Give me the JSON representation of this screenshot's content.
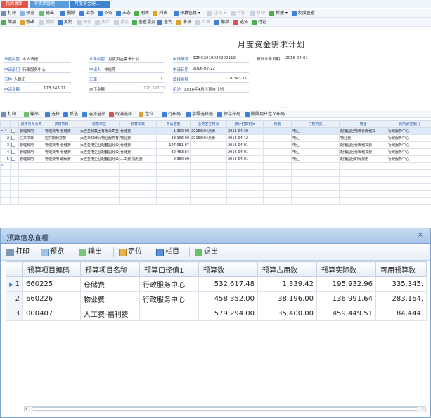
{
  "tabs": {
    "t1": "我的桌面",
    "t2": "申请单管理",
    "t3": "月度资金需…"
  },
  "toolbar1": {
    "print": "打印",
    "preview": "预览",
    "export": "输出",
    "delete": "删除",
    "first": "上条",
    "next": "下条",
    "last": "末条",
    "refresh": "刷新",
    "list": "列表",
    "budget": "预算信息",
    "attach": "注释",
    "pay": "付款",
    "send": "打印",
    "new": "新建",
    "make": "制度查看"
  },
  "toolbar2": {
    "add": "增加",
    "modify": "修改",
    "del": "删除",
    "copy": "复制",
    "save": "保存",
    "cancel": "放弃",
    "submit": "提交",
    "query_submit": "查看提交",
    "query": "查询",
    "review": "审核",
    "unreview": "弃审",
    "revoke": "撤单",
    "select": "选择",
    "discuss": "讨论"
  },
  "form": {
    "title": "月度资金需求计划",
    "doc_type_label": "单据类型",
    "doc_type": "本人填报",
    "biz_type_label": "业务类型",
    "biz_type": "月度资金需求计划",
    "doc_no_label": "申请编号",
    "doc_no": "ZZNC2019022200110",
    "date_label": "预计业务日期",
    "date": "2016-04-01",
    "dept_label": "申请部门",
    "dept": "行政服务中心",
    "applicant_label": "申请人",
    "applicant": "林晓燕",
    "apply_date_label": "申请日期",
    "apply_date": "2016-02-22",
    "currency_label": "币种",
    "currency": "人民币",
    "rate_label": "汇率",
    "rate": "1",
    "amount_label": "填报金额",
    "amount": "178,343.71",
    "req_amount_label": "申请金额",
    "req_amount": "178,343.71",
    "local_amount_label": "本币金额",
    "local_amount": "178,343.71",
    "purpose_label": "用途",
    "purpose": "2016年4月份资金计划"
  },
  "gridtoolbar": {
    "print": "打印",
    "export": "输出",
    "select": "选择",
    "invert": "反选",
    "selectall": "选择全部",
    "unselect": "取消选择",
    "locate": "定位",
    "rowlayout": "行布局",
    "filter": "字段选择器",
    "savelayout": "保存布局",
    "custom": "删除用户定义布局"
  },
  "grid": {
    "headers": [
      "费用项目大类",
      "费用项目",
      "收款单位",
      "预算项目",
      "申请金额",
      "业务发生时间",
      "预计付款时间",
      "账期",
      "付款方式",
      "用途",
      "费用承担部门"
    ],
    "rows": [
      [
        "管理费用",
        "管理费用-仓储费",
        "大连金源集团有限公司金路",
        "仓储费",
        "1,300.00",
        "2016年04月份",
        "2016-04-30",
        "",
        "电汇",
        "配置园区物流仓库租赁",
        "行政服务中心"
      ],
      [
        "往来项目",
        "应付期预交款",
        "大连华仰维行物业服务有限",
        "物业费",
        "38,196.00",
        "2016年04月份",
        "2016-04-12",
        "",
        "电汇",
        "物业费",
        "行政服务中心"
      ],
      [
        "管理费用",
        "管理费用-仓储费",
        "大连金港企业配套园分公司",
        "仓储费",
        "107,081.07",
        "",
        "2016-04-01",
        "",
        "电汇",
        "配置园区仓库租赁费",
        "行政服务中心"
      ],
      [
        "管理费用",
        "管理费用-仓储费",
        "大连金港企业配套园分公司",
        "仓储费",
        "32,463.84",
        "",
        "2016-04-01",
        "",
        "电汇",
        "配置园区仓库租赁费",
        "行政服务中心"
      ],
      [
        "管理费用",
        "管理费用-职保费",
        "大连金港企业配套园分公司",
        "人工费-福利费",
        "9,360.00",
        "",
        "2016-04-01",
        "",
        "电汇",
        "配置园区职保费用",
        "行政服务中心"
      ]
    ]
  },
  "dialog": {
    "title": "预算信息查看",
    "close": "×",
    "print": "打印",
    "preview": "预览",
    "export": "输出",
    "locate": "定位",
    "columns": "栏目",
    "exit": "退出",
    "headers": [
      "预算项目编码",
      "预算项目名称",
      "预算口径值1",
      "预算数",
      "预算占用数",
      "预算实际数",
      "可用预算数"
    ],
    "rows": [
      [
        "1",
        "660225",
        "仓储费",
        "行政服务中心",
        "532,617.48",
        "1,339.42",
        "195,932.96",
        "335,345."
      ],
      [
        "2",
        "660226",
        "物业费",
        "行政服务中心",
        "458,352.00",
        "38,196.00",
        "136,991.64",
        "283,164."
      ],
      [
        "3",
        "000407",
        "人工费-福利费",
        "",
        "579,294.00",
        "35,400.00",
        "459,449.51",
        "84,444."
      ]
    ]
  },
  "colors": {
    "accent": "#2b6cc4",
    "tab_active": "#5c9bd9",
    "selected_row": "#dde9f8"
  }
}
